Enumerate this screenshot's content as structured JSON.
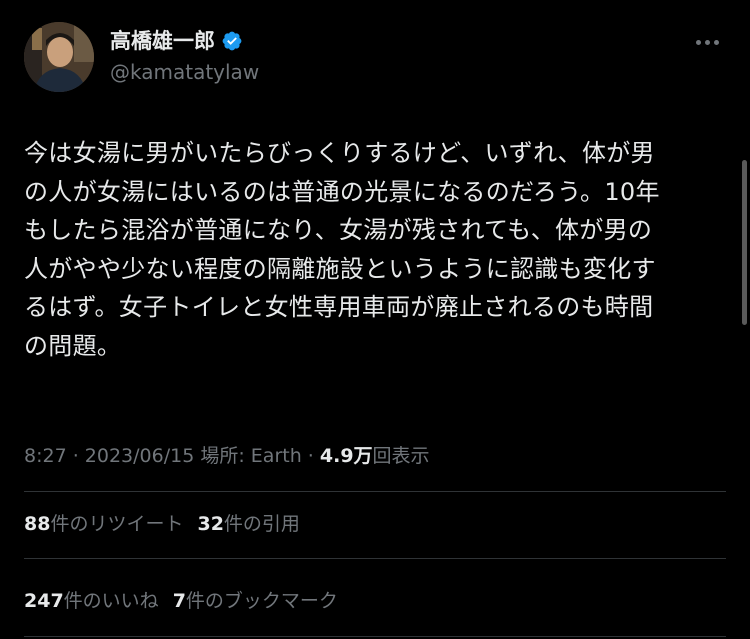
{
  "author": {
    "display_name": "高橋雄一郎",
    "handle": "@kamatatylaw",
    "verified_color": "#1d9bf0"
  },
  "tweet": {
    "lines": [
      "今は女湯に男がいたらびっくりするけど、いずれ、体が男",
      "の人が女湯にはいるのは普通の光景になるのだろう。10年",
      "もしたら混浴が普通になり、女湯が残されても、体が男の",
      "人がやや少ない程度の隔離施設というように認識も変化す",
      "るはず。女子トイレと女性専用車両が廃止されるのも時間",
      "の問題。"
    ]
  },
  "meta": {
    "time": "8:27",
    "sep1": " · ",
    "date": "2023/06/15",
    "location_label": " 場所: ",
    "location": "Earth",
    "sep2": " · ",
    "views_count": "4.9万",
    "views_label": "回表示"
  },
  "stats_row1": {
    "retweets_count": "88",
    "retweets_label": "件のリツイート",
    "quotes_count": "32",
    "quotes_label": "件の引用"
  },
  "stats_row2": {
    "likes_count": "247",
    "likes_label": "件のいいね",
    "bookmarks_count": "7",
    "bookmarks_label": "件のブックマーク"
  },
  "icons": {
    "more": "more-horizontal-icon",
    "verified": "verified-badge-icon"
  }
}
